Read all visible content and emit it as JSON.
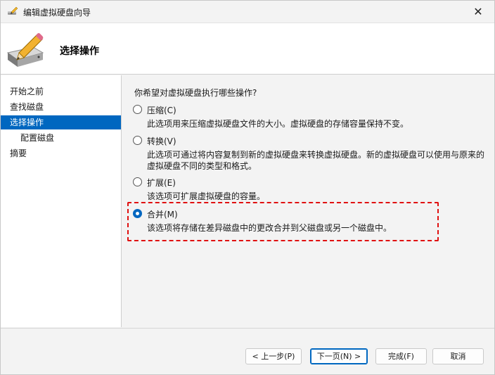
{
  "window": {
    "title": "编辑虚拟硬盘向导",
    "close_glyph": "✕"
  },
  "header": {
    "title": "选择操作",
    "icon": "disk-pencil-icon"
  },
  "nav": {
    "items": [
      {
        "label": "开始之前",
        "active": false,
        "sub": false
      },
      {
        "label": "查找磁盘",
        "active": false,
        "sub": false
      },
      {
        "label": "选择操作",
        "active": true,
        "sub": false
      },
      {
        "label": "配置磁盘",
        "active": false,
        "sub": true
      },
      {
        "label": "摘要",
        "active": false,
        "sub": false
      }
    ]
  },
  "main": {
    "question": "你希望对虚拟硬盘执行哪些操作?",
    "options": [
      {
        "label": "压缩(C)",
        "description": "此选项用来压缩虚拟硬盘文件的大小。虚拟硬盘的存储容量保持不变。",
        "checked": false
      },
      {
        "label": "转换(V)",
        "description": "此选项可通过将内容复制到新的虚拟硬盘来转换虚拟硬盘。新的虚拟硬盘可以使用与原来的虚拟硬盘不同的类型和格式。",
        "checked": false
      },
      {
        "label": "扩展(E)",
        "description": "该选项可扩展虚拟硬盘的容量。",
        "checked": false
      },
      {
        "label": "合并(M)",
        "description": "该选项将存储在差异磁盘中的更改合并到父磁盘或另一个磁盘中。",
        "checked": true
      }
    ]
  },
  "footer": {
    "prev_label": "< 上一步(P)",
    "next_label": "下一页(N) >",
    "finish_label": "完成(F)",
    "cancel_label": "取消"
  },
  "colors": {
    "accent": "#0067c0",
    "highlight": "#e01010"
  }
}
